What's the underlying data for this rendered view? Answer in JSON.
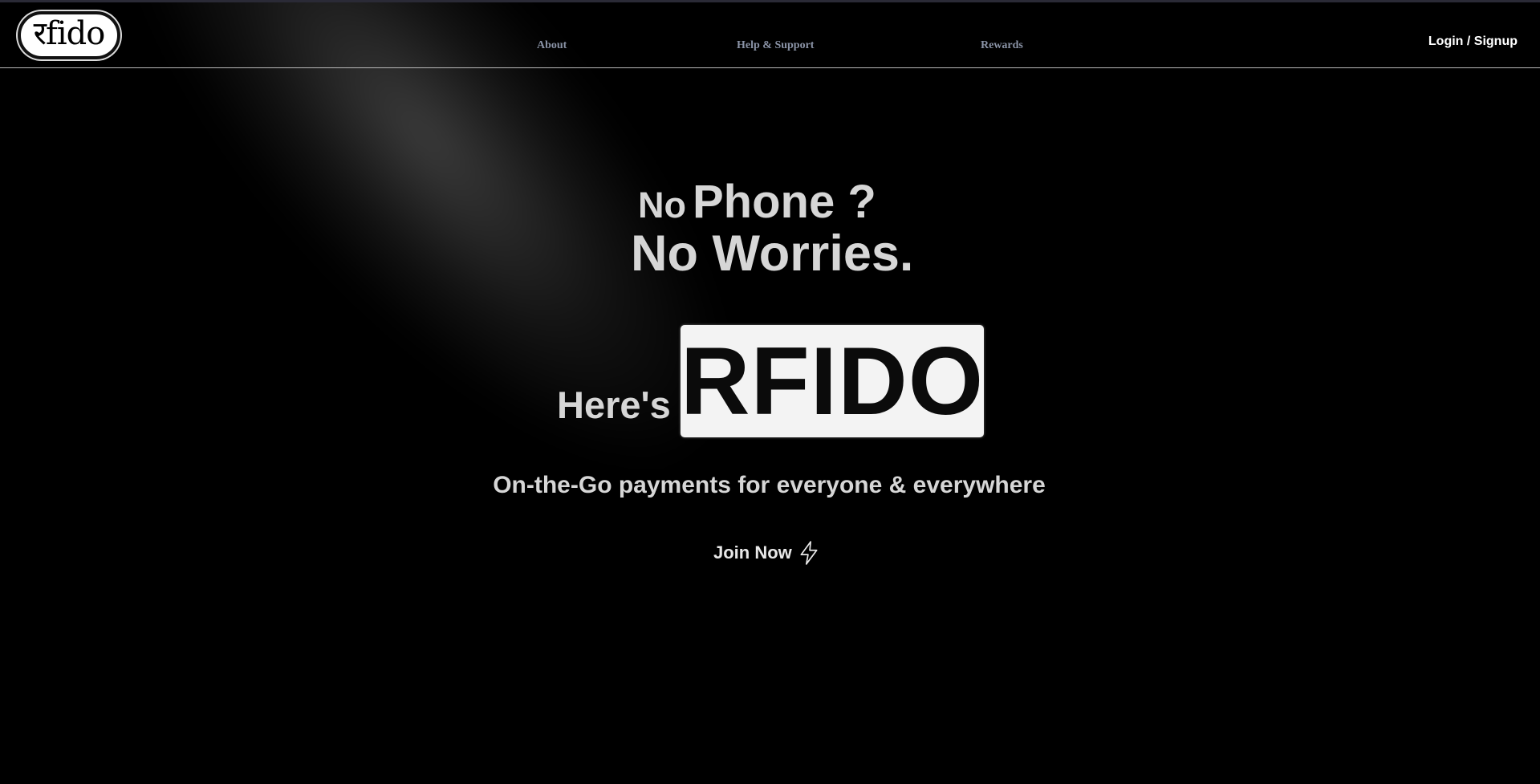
{
  "nav": {
    "logo_text": "रfido",
    "links": [
      "About",
      "Help & Support",
      "Rewards"
    ],
    "login_label": "Login / Signup"
  },
  "hero": {
    "line1_small": "No",
    "line1_big": "Phone ?",
    "line2": "No Worries.",
    "heres": "Here's",
    "brand": "RFIDO",
    "tagline": "On-the-Go payments for everyone & everywhere",
    "cta_label": "Join Now",
    "cta_icon": "lightning-bolt-icon"
  },
  "colors": {
    "background": "#000000",
    "text": "#d6d6d6",
    "nav_link": "#8a93a6",
    "brand_box": "#f3f3f3"
  }
}
